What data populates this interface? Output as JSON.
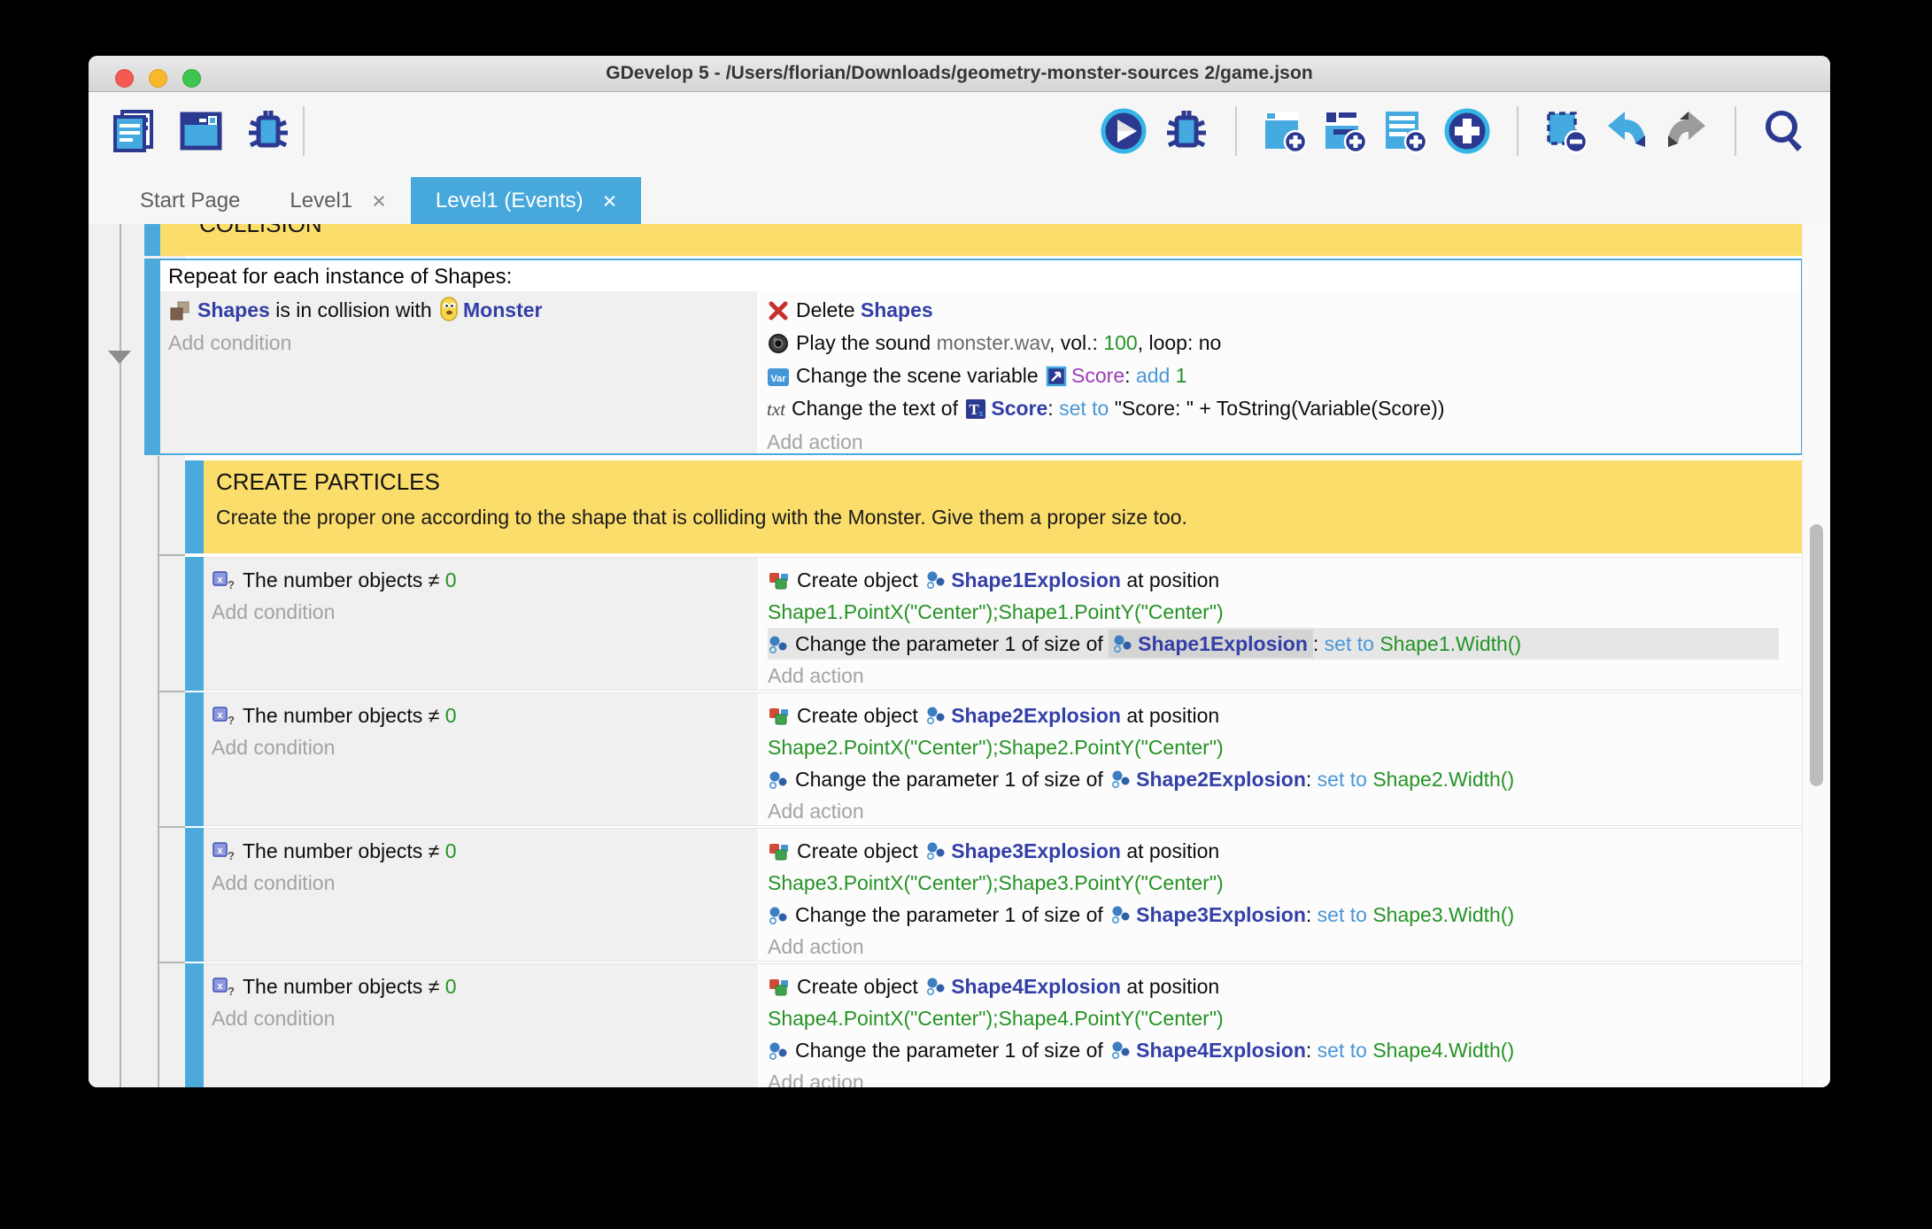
{
  "window": {
    "title": "GDevelop 5 - /Users/florian/Downloads/geometry-monster-sources 2/game.json"
  },
  "toolbar": {
    "left_icons": [
      "project-manager-icon",
      "start-page-icon",
      "debugger-icon"
    ],
    "right_icons": [
      "preview-play-icon",
      "debug-icon",
      "add-event-icon",
      "add-subevent-icon",
      "add-comment-icon",
      "add-plus-icon",
      "remove-event-icon",
      "undo-icon",
      "redo-icon",
      "search-icon"
    ]
  },
  "tabs": {
    "close_glyph": "×",
    "items": [
      {
        "label": "Start Page"
      },
      {
        "label": "Level1"
      },
      {
        "label": "Level1 (Events)"
      }
    ]
  },
  "labels": {
    "add_condition": "Add condition",
    "add_action": "Add action",
    "colon": ":"
  },
  "collision_group": {
    "title": "COLLISION"
  },
  "repeat_event": {
    "header": "Repeat for each instance of Shapes:",
    "condition": {
      "object1": "Shapes",
      "middle": "is in collision with",
      "object2": "Monster"
    },
    "actions": {
      "delete": {
        "label": "Delete",
        "object": "Shapes"
      },
      "sound": {
        "label": "Play the sound",
        "file": "monster.wav",
        "vol_label": ", vol.:",
        "vol": "100",
        "loop_label": ", loop:",
        "loop": "no"
      },
      "variable": {
        "label": "Change the scene variable",
        "name": "Score",
        "op": "add",
        "value": "1"
      },
      "text": {
        "label": "Change the text of",
        "object": "Score",
        "keyword": "set to",
        "value": "\"Score: \" + ToString(Variable(Score))"
      }
    }
  },
  "particles_group": {
    "title": "CREATE PARTICLES",
    "description": "Create the proper one according to the shape that is colliding with the Monster. Give them a proper size too."
  },
  "shape_events": [
    {
      "condition": {
        "label": "The number objects",
        "op": "≠",
        "value": "0"
      },
      "create": {
        "label": "Create object",
        "object": "Shape1Explosion",
        "suffix": "at position",
        "expression": "Shape1.PointX(\"Center\");Shape1.PointY(\"Center\")"
      },
      "resize": {
        "label": "Change the parameter 1 of size of",
        "object": "Shape1Explosion",
        "keyword": "set to",
        "expression": "Shape1.Width()"
      }
    },
    {
      "condition": {
        "label": "The number objects",
        "op": "≠",
        "value": "0"
      },
      "create": {
        "label": "Create object",
        "object": "Shape2Explosion",
        "suffix": "at position",
        "expression": "Shape2.PointX(\"Center\");Shape2.PointY(\"Center\")"
      },
      "resize": {
        "label": "Change the parameter 1 of size of",
        "object": "Shape2Explosion",
        "keyword": "set to",
        "expression": "Shape2.Width()"
      }
    },
    {
      "condition": {
        "label": "The number objects",
        "op": "≠",
        "value": "0"
      },
      "create": {
        "label": "Create object",
        "object": "Shape3Explosion",
        "suffix": "at position",
        "expression": "Shape3.PointX(\"Center\");Shape3.PointY(\"Center\")"
      },
      "resize": {
        "label": "Change the parameter 1 of size of",
        "object": "Shape3Explosion",
        "keyword": "set to",
        "expression": "Shape3.Width()"
      }
    },
    {
      "condition": {
        "label": "The number objects",
        "op": "≠",
        "value": "0"
      },
      "create": {
        "label": "Create object",
        "object": "Shape4Explosion",
        "suffix": "at position",
        "expression": "Shape4.PointX(\"Center\");Shape4.PointY(\"Center\")"
      },
      "resize": {
        "label": "Change the parameter 1 of size of",
        "object": "Shape4Explosion",
        "keyword": "set to",
        "expression": "Shape4.Width()"
      }
    }
  ]
}
